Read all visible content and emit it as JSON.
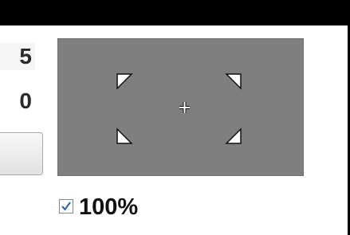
{
  "fields": {
    "top_value_partial": "5",
    "mid_value_partial": "0"
  },
  "scale": {
    "checkbox_checked": true,
    "label": "100%"
  },
  "colors": {
    "preview_bg": "#7f7f7f",
    "top_bar": "#000000"
  },
  "icons": {
    "corner": "corner-bracket-icon",
    "center": "crosshair-icon"
  }
}
